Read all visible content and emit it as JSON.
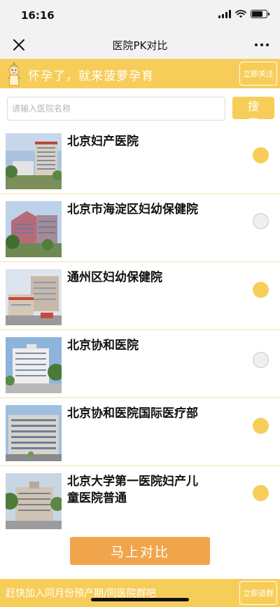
{
  "status_bar": {
    "time": "16:16",
    "battery_level": 0.75
  },
  "nav": {
    "title": "医院PK对比",
    "close_icon": "close-icon",
    "more_icon": "more-icon"
  },
  "promo_top": {
    "text": "怀孕了，就来菠萝孕育",
    "follow_label": "立即关注"
  },
  "search": {
    "placeholder": "请输入医院名称",
    "value": "",
    "button_label": "搜 索"
  },
  "hospitals": [
    {
      "name": "北京妇产医院",
      "selected": true
    },
    {
      "name": "北京市海淀区妇幼保健院",
      "selected": false
    },
    {
      "name": "通州区妇幼保健院",
      "selected": true
    },
    {
      "name": "北京协和医院",
      "selected": false
    },
    {
      "name": "北京协和医院国际医疗部",
      "selected": true
    },
    {
      "name": "北京大学第一医院妇产儿童医院普通",
      "selected": true
    }
  ],
  "compare_button": {
    "label": "马上对比"
  },
  "promo_bottom": {
    "text": "赶快加入同月份预产期/同医院群吧",
    "join_label": "立即进群"
  },
  "colors": {
    "accent": "#f7cd59",
    "compare": "#f0a54c",
    "divider": "#f4e3ad"
  }
}
